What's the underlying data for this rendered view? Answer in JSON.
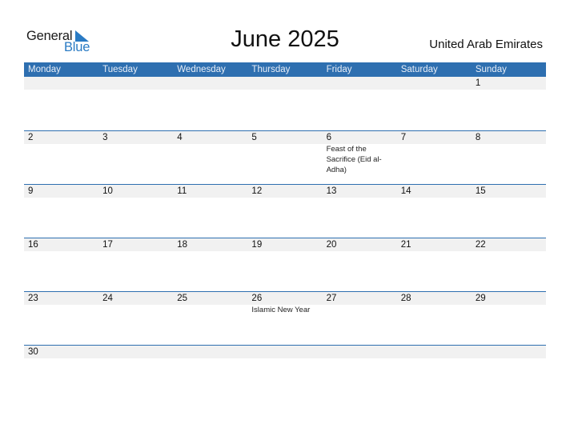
{
  "logo": {
    "word1": "General",
    "word2": "Blue",
    "accent_color": "#2a7bc4"
  },
  "title": "June 2025",
  "country": "United Arab Emirates",
  "colors": {
    "header_bg": "#2e6fb0",
    "row_band": "#f1f1f1"
  },
  "weekdays": [
    "Monday",
    "Tuesday",
    "Wednesday",
    "Thursday",
    "Friday",
    "Saturday",
    "Sunday"
  ],
  "weeks": [
    [
      {
        "day": ""
      },
      {
        "day": ""
      },
      {
        "day": ""
      },
      {
        "day": ""
      },
      {
        "day": ""
      },
      {
        "day": ""
      },
      {
        "day": "1"
      }
    ],
    [
      {
        "day": "2"
      },
      {
        "day": "3"
      },
      {
        "day": "4"
      },
      {
        "day": "5"
      },
      {
        "day": "6",
        "event": "Feast of the Sacrifice (Eid al-Adha)"
      },
      {
        "day": "7"
      },
      {
        "day": "8"
      }
    ],
    [
      {
        "day": "9"
      },
      {
        "day": "10"
      },
      {
        "day": "11"
      },
      {
        "day": "12"
      },
      {
        "day": "13"
      },
      {
        "day": "14"
      },
      {
        "day": "15"
      }
    ],
    [
      {
        "day": "16"
      },
      {
        "day": "17"
      },
      {
        "day": "18"
      },
      {
        "day": "19"
      },
      {
        "day": "20"
      },
      {
        "day": "21"
      },
      {
        "day": "22"
      }
    ],
    [
      {
        "day": "23"
      },
      {
        "day": "24"
      },
      {
        "day": "25"
      },
      {
        "day": "26",
        "event": "Islamic New Year"
      },
      {
        "day": "27"
      },
      {
        "day": "28"
      },
      {
        "day": "29"
      }
    ],
    [
      {
        "day": "30"
      },
      {
        "day": ""
      },
      {
        "day": ""
      },
      {
        "day": ""
      },
      {
        "day": ""
      },
      {
        "day": ""
      },
      {
        "day": ""
      }
    ]
  ]
}
